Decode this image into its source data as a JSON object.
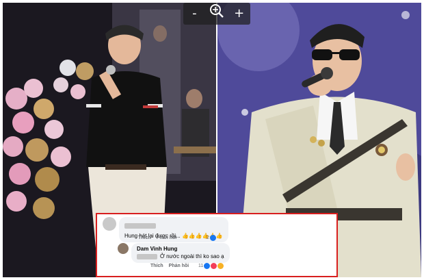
{
  "zoom": {
    "zoom_out": "-",
    "zoom_in": "+"
  },
  "comments": [
    {
      "text": "Hung hát lại được rồi... 👍👍👍👍👍👍",
      "actions": [
        "Thích",
        "Phản hồi"
      ],
      "reaction_count": "2"
    },
    {
      "author": "Dam Vinh Hung",
      "text": "Ở nước ngoài thì ko sao ạ",
      "actions": [
        "Thích",
        "Phản hồi"
      ],
      "reaction_count": "11"
    }
  ],
  "colors": {
    "highlight_border": "#d81e1e",
    "like_blue": "#1877f2",
    "love_red": "#f33e58",
    "haha_yellow": "#f7b125"
  }
}
